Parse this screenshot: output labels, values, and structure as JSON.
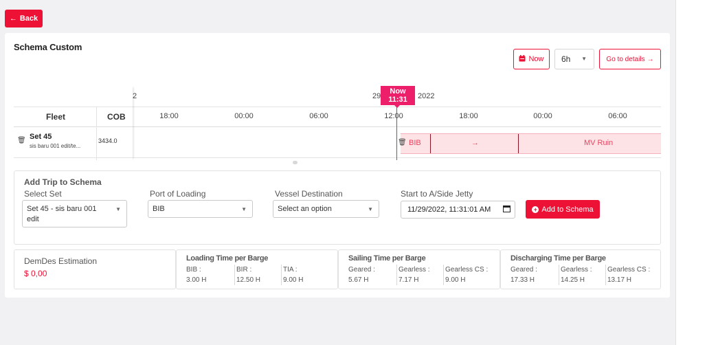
{
  "back_label": "Back",
  "page_title": "Schema Custom",
  "toolbar": {
    "now_label": "Now",
    "range_value": "6h",
    "details_label": "Go to details"
  },
  "timeline": {
    "date_left": "2",
    "date_center": "29",
    "date_right": "2022",
    "now_flag_line1": "Now",
    "now_flag_line2": "11:31",
    "header_fleet": "Fleet",
    "header_cob": "COB",
    "ticks": [
      "18:00",
      "00:00",
      "06:00",
      "12:00",
      "18:00",
      "00:00",
      "06:00"
    ],
    "row": {
      "set_name": "Set 45",
      "set_sub": "sis baru 001 edit/te...",
      "cob": "3434.0",
      "bar_start": "BIB",
      "bar_arrow": "→",
      "bar_end": "MV Ruin"
    }
  },
  "form": {
    "title": "Add Trip to Schema",
    "select_set_label": "Select Set",
    "select_set_value_line1": "Set 45 - sis baru 001",
    "select_set_value_line2": "edit",
    "port_label": "Port of Loading",
    "port_value": "BIB",
    "vessel_label": "Vessel Destination",
    "vessel_placeholder": "Select an option",
    "start_label": "Start to A/Side Jetty",
    "start_value": "11/29/2022, 11:31:01 AM",
    "add_label": "Add to Schema"
  },
  "estimation": {
    "demdes_label": "DemDes Estimation",
    "demdes_value": "$ 0,00",
    "loading": {
      "title": "Loading Time per Barge",
      "items": [
        {
          "name": "BIB :",
          "value": "3.00 H"
        },
        {
          "name": "BIR :",
          "value": "12.50 H"
        },
        {
          "name": "TIA :",
          "value": "9.00 H"
        }
      ]
    },
    "sailing": {
      "title": "Sailing Time per Barge",
      "items": [
        {
          "name": "Geared :",
          "value": "5.67 H"
        },
        {
          "name": "Gearless :",
          "value": "7.17 H"
        },
        {
          "name": "Gearless CS :",
          "value": "9.00 H"
        }
      ]
    },
    "discharging": {
      "title": "Discharging Time per Barge",
      "items": [
        {
          "name": "Geared :",
          "value": "17.33 H"
        },
        {
          "name": "Gearless :",
          "value": "14.25 H"
        },
        {
          "name": "Gearless CS :",
          "value": "13.17 H"
        }
      ]
    }
  }
}
